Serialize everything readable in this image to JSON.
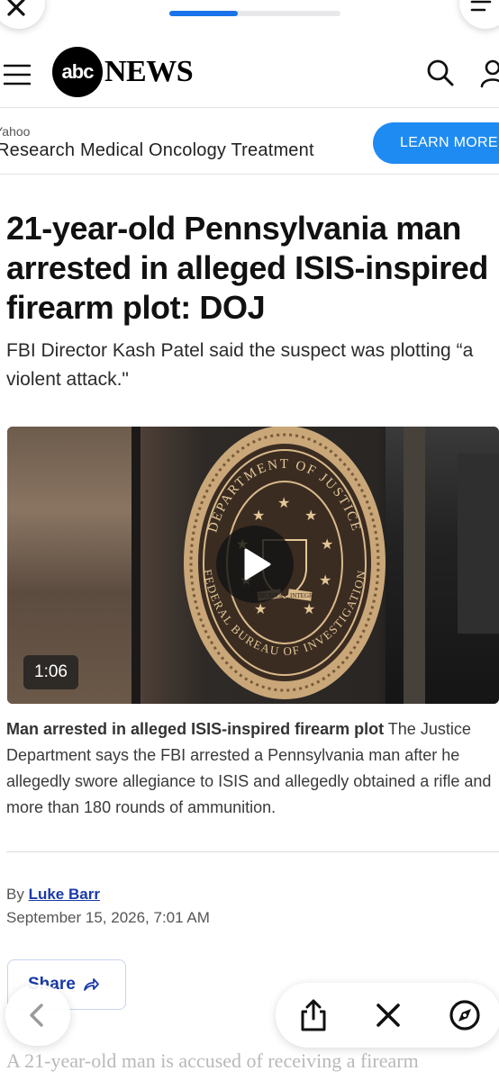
{
  "browser": {
    "load_progress": 0.4,
    "accent": "#1a73e8"
  },
  "header": {
    "logo_mark": "abc",
    "logo_word": "NEWS",
    "icons": [
      "hamburger-menu-icon",
      "search-icon",
      "account-icon"
    ]
  },
  "ad": {
    "source": "Yahoo",
    "title": "Research Medical Oncology Treatment",
    "cta": "LEARN MORE",
    "cta_color": "#1e8bf3"
  },
  "article": {
    "headline": "21-year-old Pennsylvania man arrested in alleged ISIS-inspired firearm plot: DOJ",
    "dek": "FBI Director Kash Patel said the suspect was plotting “a violent attack.\"",
    "video": {
      "duration": "1:06",
      "seal_top_text": "DEPARTMENT OF JUSTICE",
      "seal_bottom_text": "FEDERAL BUREAU OF INVESTIGATION",
      "seal_ribbon_left": "BRAVERY",
      "seal_ribbon_right": "INTEGRITY"
    },
    "caption_lead": "Man arrested in alleged ISIS-inspired firearm plot",
    "caption_body": "The Justice Department says the FBI arrested a Pennsylvania man after he allegedly swore allegiance to ISIS and allegedly obtained a rifle and more than 180 rounds of ammunition.",
    "byline_prefix": "By",
    "author": "Luke Barr",
    "date": "September 15, 2026, 7:01 AM",
    "share_label": "Share",
    "body_start": "A 21-year-old man is accused of receiving a firearm"
  },
  "toolbar": {
    "icons": [
      "back-icon",
      "share-icon",
      "close-icon",
      "compass-icon"
    ]
  }
}
